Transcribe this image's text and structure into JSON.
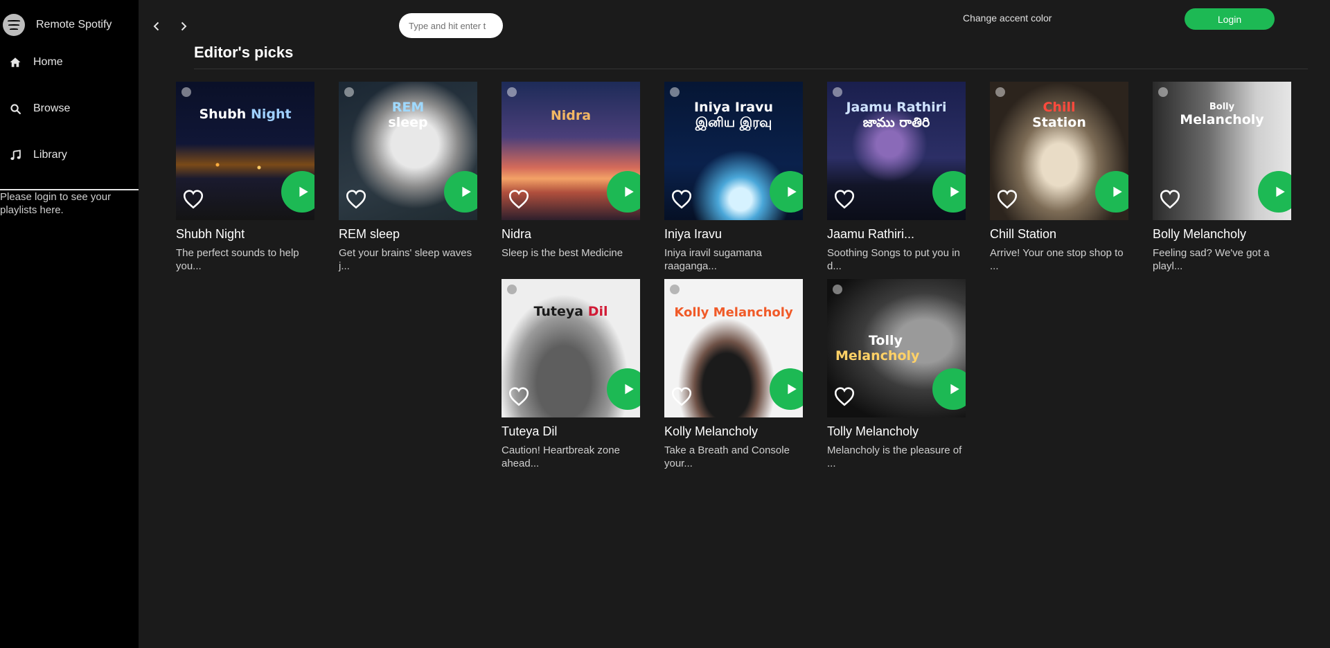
{
  "app": {
    "name": "Remote Spotify"
  },
  "sidebar": {
    "items": [
      {
        "label": "Home",
        "icon": "home-icon"
      },
      {
        "label": "Browse",
        "icon": "search-icon"
      },
      {
        "label": "Library",
        "icon": "music-note-icon"
      }
    ],
    "login_note": "Please login to see your playlists here."
  },
  "topbar": {
    "search_placeholder": "Type and hit enter t",
    "accent_label": "Change accent color",
    "login_label": "Login"
  },
  "section": {
    "title": "Editor's picks"
  },
  "colors": {
    "accent": "#1db954",
    "background": "#1b1b1b",
    "sidebar": "#000000"
  },
  "playlists": [
    {
      "title": "Shubh Night",
      "description": "The perfect sounds to help you...",
      "cover_a": "Shubh",
      "cover_b": "Night",
      "cover_a_color": "#ffffff",
      "cover_b_color": "#9fd0ff"
    },
    {
      "title": "REM sleep",
      "description": "Get your brains' sleep waves j...",
      "cover_a": "REM",
      "cover_b": "sleep",
      "cover_a_color": "#9fd9ff",
      "cover_b_color": "#ffffff"
    },
    {
      "title": "Nidra",
      "description": "Sleep is the best Medicine",
      "cover_a": "Nidra",
      "cover_b": "",
      "cover_a_color": "#f2b764",
      "cover_b_color": "#ffffff"
    },
    {
      "title": "Iniya Iravu",
      "description": "Iniya iravil sugamana raaganga...",
      "cover_a": "Iniya Iravu",
      "cover_b": "இனிய இரவு",
      "cover_a_color": "#ffffff",
      "cover_b_color": "#ffffff"
    },
    {
      "title": "Jaamu Rathiri...",
      "description": "Soothing Songs to put you in d...",
      "cover_a": "Jaamu Rathiri",
      "cover_b": "జాము రాతిరి",
      "cover_a_color": "#cfe3ff",
      "cover_b_color": "#ffffff"
    },
    {
      "title": "Chill Station",
      "description": "Arrive! Your one stop shop to ...",
      "cover_a": "Chill",
      "cover_b": "Station",
      "cover_a_color": "#ff4a3d",
      "cover_b_color": "#ffffff"
    },
    {
      "title": "Bolly Melancholy",
      "description": "Feeling sad? We've got a playl...",
      "cover_a": "Bolly",
      "cover_b": "Melancholy",
      "cover_a_color": "#ffffff",
      "cover_b_color": "#ffffff"
    },
    {
      "title": "Tuteya Dil",
      "description": "Caution! Heartbreak zone ahead...",
      "cover_a": "Tuteya",
      "cover_b": "Dil",
      "cover_a_color": "#1a1a1a",
      "cover_b_color": "#d11b36"
    },
    {
      "title": "Kolly Melancholy",
      "description": "Take a Breath and Console your...",
      "cover_a": "Kolly Melancholy",
      "cover_b": "",
      "cover_a_color": "#f05a28",
      "cover_b_color": "#ffffff"
    },
    {
      "title": "Tolly Melancholy",
      "description": "Melancholy is the pleasure of ...",
      "cover_a": "Tolly",
      "cover_b": "Melancholy",
      "cover_a_color": "#ffffff",
      "cover_b_color": "#ffd166"
    }
  ]
}
